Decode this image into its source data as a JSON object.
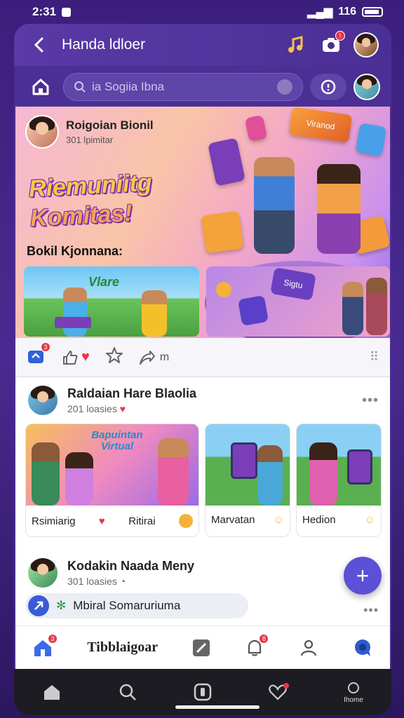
{
  "status": {
    "time": "2:31",
    "right_text": "116"
  },
  "header": {
    "title": "Handa ldloer",
    "back_icon": "back-arrow-icon"
  },
  "search": {
    "placeholder": "ia Sogiia Ibna"
  },
  "hero": {
    "poster_name": "Roigoian Bionil",
    "poster_sub": "301 lpimitar",
    "headline_line1": "Riemuniitg",
    "headline_line2": "Komitas!",
    "section_label": "Bokil Kjonnana:",
    "thumb1_label": "Vlare",
    "tile_label": "Viranod",
    "stage_label": "Sigtu"
  },
  "actions": {
    "share_count": "3",
    "send_label": "m"
  },
  "post1": {
    "name": "Raldaian Hare Blaolia",
    "sub": "201 loasies",
    "banner_text": "Bapuintan Virtual",
    "cards": [
      {
        "label": "Rsimiarig"
      },
      {
        "label": "Ritirai"
      },
      {
        "label": "Marvatan"
      },
      {
        "label": "Hedion"
      }
    ]
  },
  "post2": {
    "name": "Kodakin Naada Meny",
    "sub": "301 loasies"
  },
  "chip": {
    "label": "Mbiral Somaruriuma"
  },
  "fab": {
    "label": "+"
  },
  "tabbar": {
    "label": "Tibblaigoar",
    "home_badge": "3",
    "notif_badge": "8"
  },
  "navbar": {
    "profile_label": "Ihome"
  },
  "colors": {
    "accent": "#5b50d6",
    "header": "#4a2f95",
    "badge": "#e8364a"
  }
}
